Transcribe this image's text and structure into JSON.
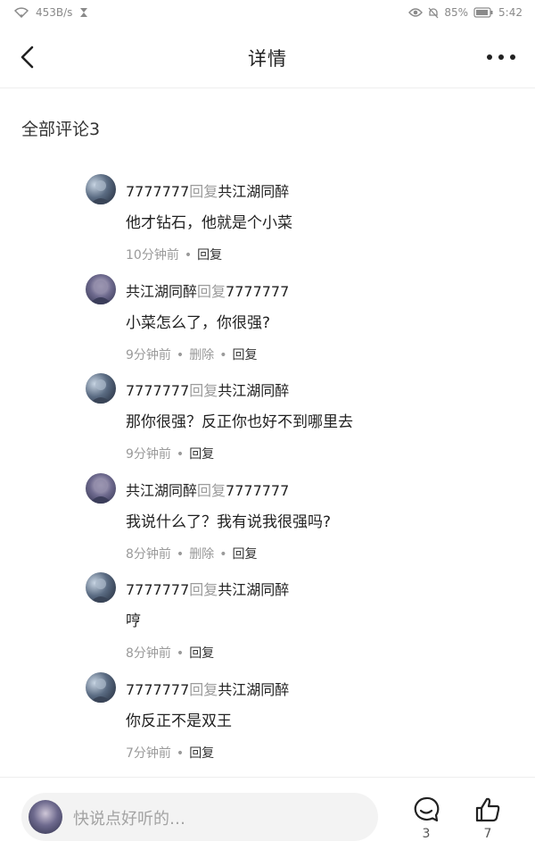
{
  "status_bar": {
    "network_speed": "453B/s",
    "battery_percent": "85%",
    "time": "5:42"
  },
  "header": {
    "title": "详情"
  },
  "comments_section": {
    "title": "全部评论3"
  },
  "comments": [
    {
      "author": "7777777",
      "reply_word": "回复",
      "target": "共江湖同醉",
      "text": "他才钻石，他就是个小菜",
      "time": "10分钟前",
      "delete_label": "",
      "reply_label": "回复",
      "avatar": "a7"
    },
    {
      "author": "共江湖同醉",
      "reply_word": "回复",
      "target": "7777777",
      "text": "小菜怎么了，你很强?",
      "time": "9分钟前",
      "delete_label": "删除",
      "reply_label": "回复",
      "avatar": "gj"
    },
    {
      "author": "7777777",
      "reply_word": "回复",
      "target": "共江湖同醉",
      "text": "那你很强？反正你也好不到哪里去",
      "time": "9分钟前",
      "delete_label": "",
      "reply_label": "回复",
      "avatar": "a7"
    },
    {
      "author": "共江湖同醉",
      "reply_word": "回复",
      "target": "7777777",
      "text": "我说什么了？我有说我很强吗?",
      "time": "8分钟前",
      "delete_label": "删除",
      "reply_label": "回复",
      "avatar": "gj"
    },
    {
      "author": "7777777",
      "reply_word": "回复",
      "target": "共江湖同醉",
      "text": "哼",
      "time": "8分钟前",
      "delete_label": "",
      "reply_label": "回复",
      "avatar": "a7"
    },
    {
      "author": "7777777",
      "reply_word": "回复",
      "target": "共江湖同醉",
      "text": "你反正不是双王",
      "time": "7分钟前",
      "delete_label": "",
      "reply_label": "回复",
      "avatar": "a7"
    }
  ],
  "bottom_bar": {
    "input_placeholder": "快说点好听的…",
    "comment_count": "3",
    "like_count": "7",
    "comment_icon": "comment-bubble-icon",
    "like_icon": "thumbs-up-icon"
  }
}
